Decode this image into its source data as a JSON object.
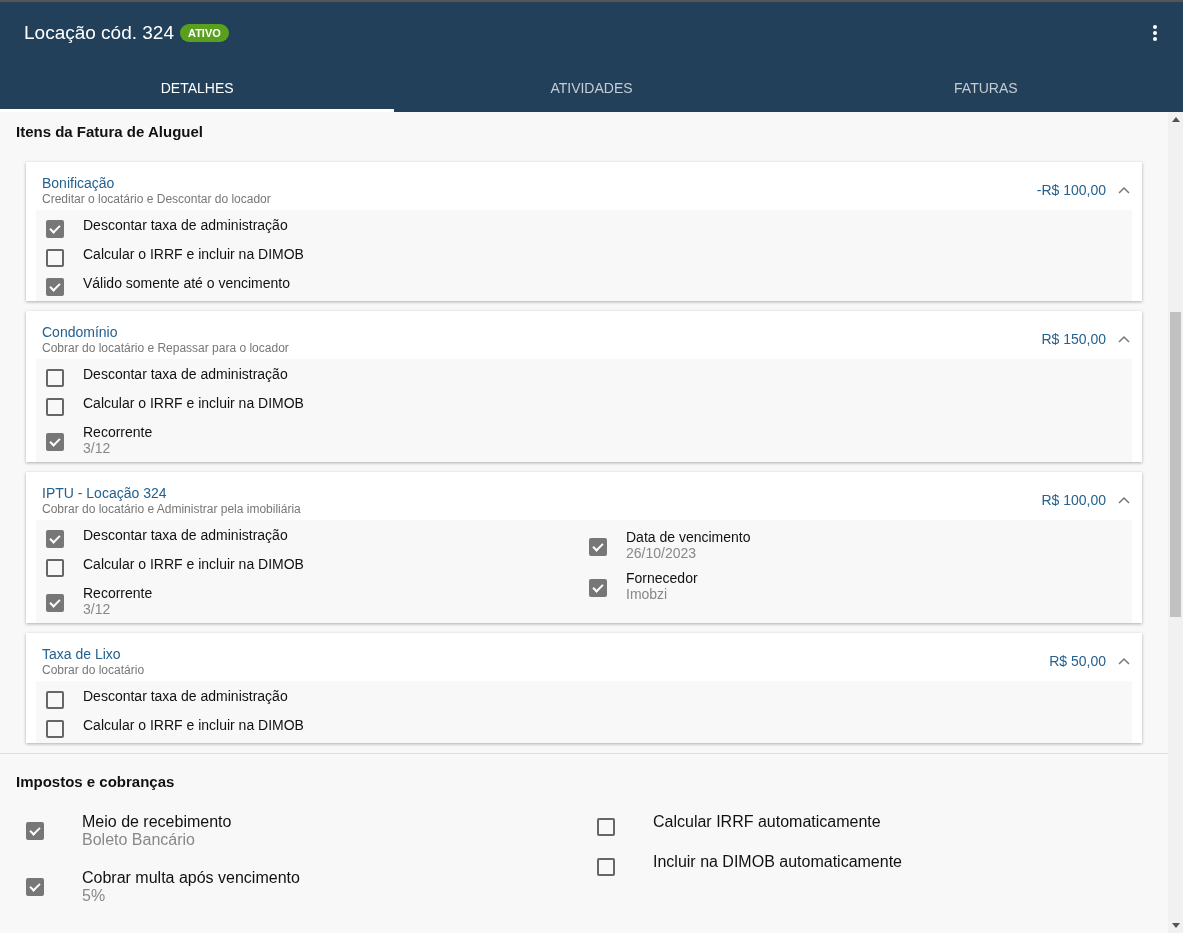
{
  "header": {
    "title": "Locação cód. 324",
    "status_badge": "ATIVO"
  },
  "tabs": [
    {
      "label": "DETALHES",
      "selected": true
    },
    {
      "label": "ATIVIDADES",
      "selected": false
    },
    {
      "label": "FATURAS",
      "selected": false
    }
  ],
  "invoice_items": {
    "title": "Itens da Fatura de Aluguel",
    "items": [
      {
        "title": "Bonificação",
        "subtitle": "Creditar o locatário e Descontar do locador",
        "amount": "-R$ 100,00",
        "expanded": true,
        "options_left": [
          {
            "label": "Descontar taxa de administração",
            "checked": true
          },
          {
            "label": "Calcular o IRRF e incluir na DIMOB",
            "checked": false
          },
          {
            "label": "Válido somente até o vencimento",
            "checked": true
          }
        ]
      },
      {
        "title": "Condomínio",
        "subtitle": "Cobrar do locatário e Repassar para o locador",
        "amount": "R$ 150,00",
        "expanded": true,
        "options_left": [
          {
            "label": "Descontar taxa de administração",
            "checked": false
          },
          {
            "label": "Calcular o IRRF e incluir na DIMOB",
            "checked": false
          },
          {
            "label": "Recorrente",
            "value": "3/12",
            "checked": true
          }
        ]
      },
      {
        "title": "IPTU - Locação 324",
        "subtitle": "Cobrar do locatário e Administrar pela imobiliária",
        "amount": "R$ 100,00",
        "expanded": true,
        "options_left": [
          {
            "label": "Descontar taxa de administração",
            "checked": true
          },
          {
            "label": "Calcular o IRRF e incluir na DIMOB",
            "checked": false
          },
          {
            "label": "Recorrente",
            "value": "3/12",
            "checked": true
          }
        ],
        "options_right": [
          {
            "label": "Data de vencimento",
            "value": "26/10/2023",
            "checked": true
          },
          {
            "label": "Fornecedor",
            "value": "Imobzi",
            "checked": true
          }
        ]
      },
      {
        "title": "Taxa de Lixo",
        "subtitle": "Cobrar do locatário",
        "amount": "R$ 50,00",
        "expanded": true,
        "options_left": [
          {
            "label": "Descontar taxa de administração",
            "checked": false
          },
          {
            "label": "Calcular o IRRF e incluir na DIMOB",
            "checked": false
          }
        ]
      }
    ]
  },
  "taxes": {
    "title": "Impostos e cobranças",
    "options_left": [
      {
        "label": "Meio de recebimento",
        "value": "Boleto Bancário",
        "checked": true
      },
      {
        "label": "Cobrar multa após vencimento",
        "value": "5%",
        "checked": true
      }
    ],
    "options_right": [
      {
        "label": "Calcular IRRF automaticamente",
        "checked": false
      },
      {
        "label": "Incluir na DIMOB automaticamente",
        "checked": false
      }
    ]
  }
}
